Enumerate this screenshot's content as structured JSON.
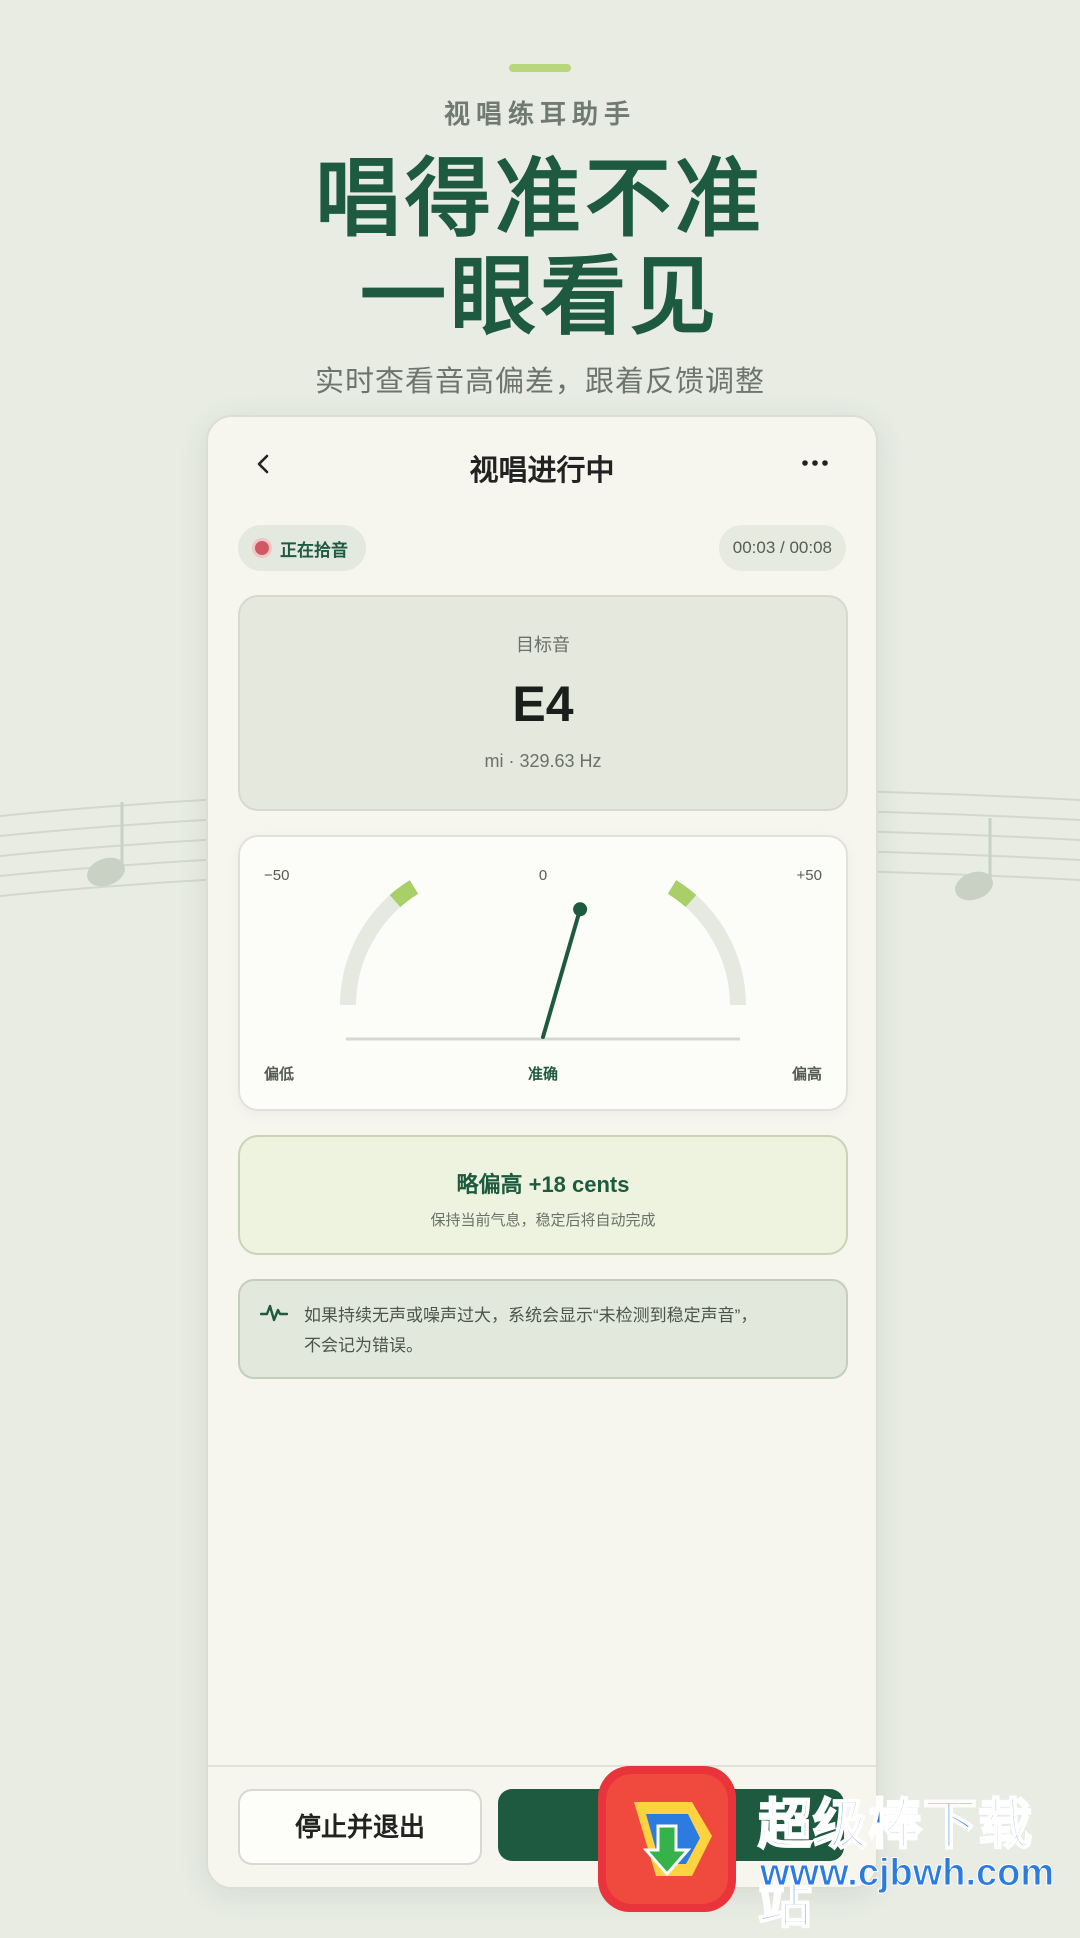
{
  "promo": {
    "kicker": "视唱练耳助手",
    "headline_line1": "唱得准不准",
    "headline_line2": "一眼看见",
    "subhead": "实时查看音高偏差，跟着反馈调整"
  },
  "screen": {
    "title": "视唱进行中",
    "status_label": "正在拾音",
    "timer": "00:03 / 00:08"
  },
  "target": {
    "label": "目标音",
    "note": "E4",
    "detail": "mi · 329.63 Hz"
  },
  "meter": {
    "min_label": "−50",
    "zero_label": "0",
    "max_label": "+50",
    "low_label": "偏低",
    "center_label": "准确",
    "high_label": "偏高",
    "cents": 18
  },
  "feedback": {
    "title": "略偏高 +18 cents",
    "subtitle": "保持当前气息，稳定后将自动完成"
  },
  "hint": {
    "line1": "如果持续无声或噪声过大，系统会显示“未检测到稳定声音”，",
    "line2": "不会记为错误。"
  },
  "actions": {
    "stop_label": "停止并退出",
    "primary_label": ""
  },
  "watermark": {
    "site_name": "超级棒下载站",
    "site_url": "www.cjbwh.com"
  },
  "colors": {
    "brand": "#1d5a3f",
    "accent": "#b8d67c",
    "recording": "#d05a62"
  }
}
